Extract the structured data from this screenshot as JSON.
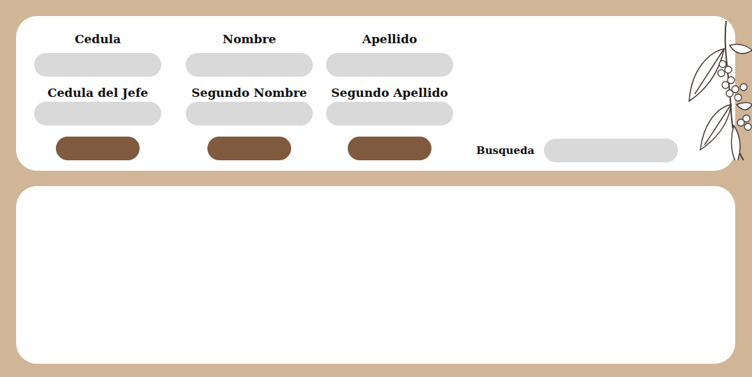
{
  "form": {
    "columns": [
      {
        "fields": [
          {
            "label": "Cedula",
            "value": ""
          },
          {
            "label": "Cedula del Jefe",
            "value": ""
          }
        ],
        "button": {
          "label": ""
        }
      },
      {
        "fields": [
          {
            "label": "Nombre",
            "value": ""
          },
          {
            "label": "Segundo Nombre",
            "value": ""
          }
        ],
        "button": {
          "label": ""
        }
      },
      {
        "fields": [
          {
            "label": "Apellido",
            "value": ""
          },
          {
            "label": "Segundo Apellido",
            "value": ""
          }
        ],
        "button": {
          "label": ""
        }
      }
    ]
  },
  "search": {
    "label": "Busqueda",
    "value": ""
  },
  "results": {
    "rows": []
  }
}
